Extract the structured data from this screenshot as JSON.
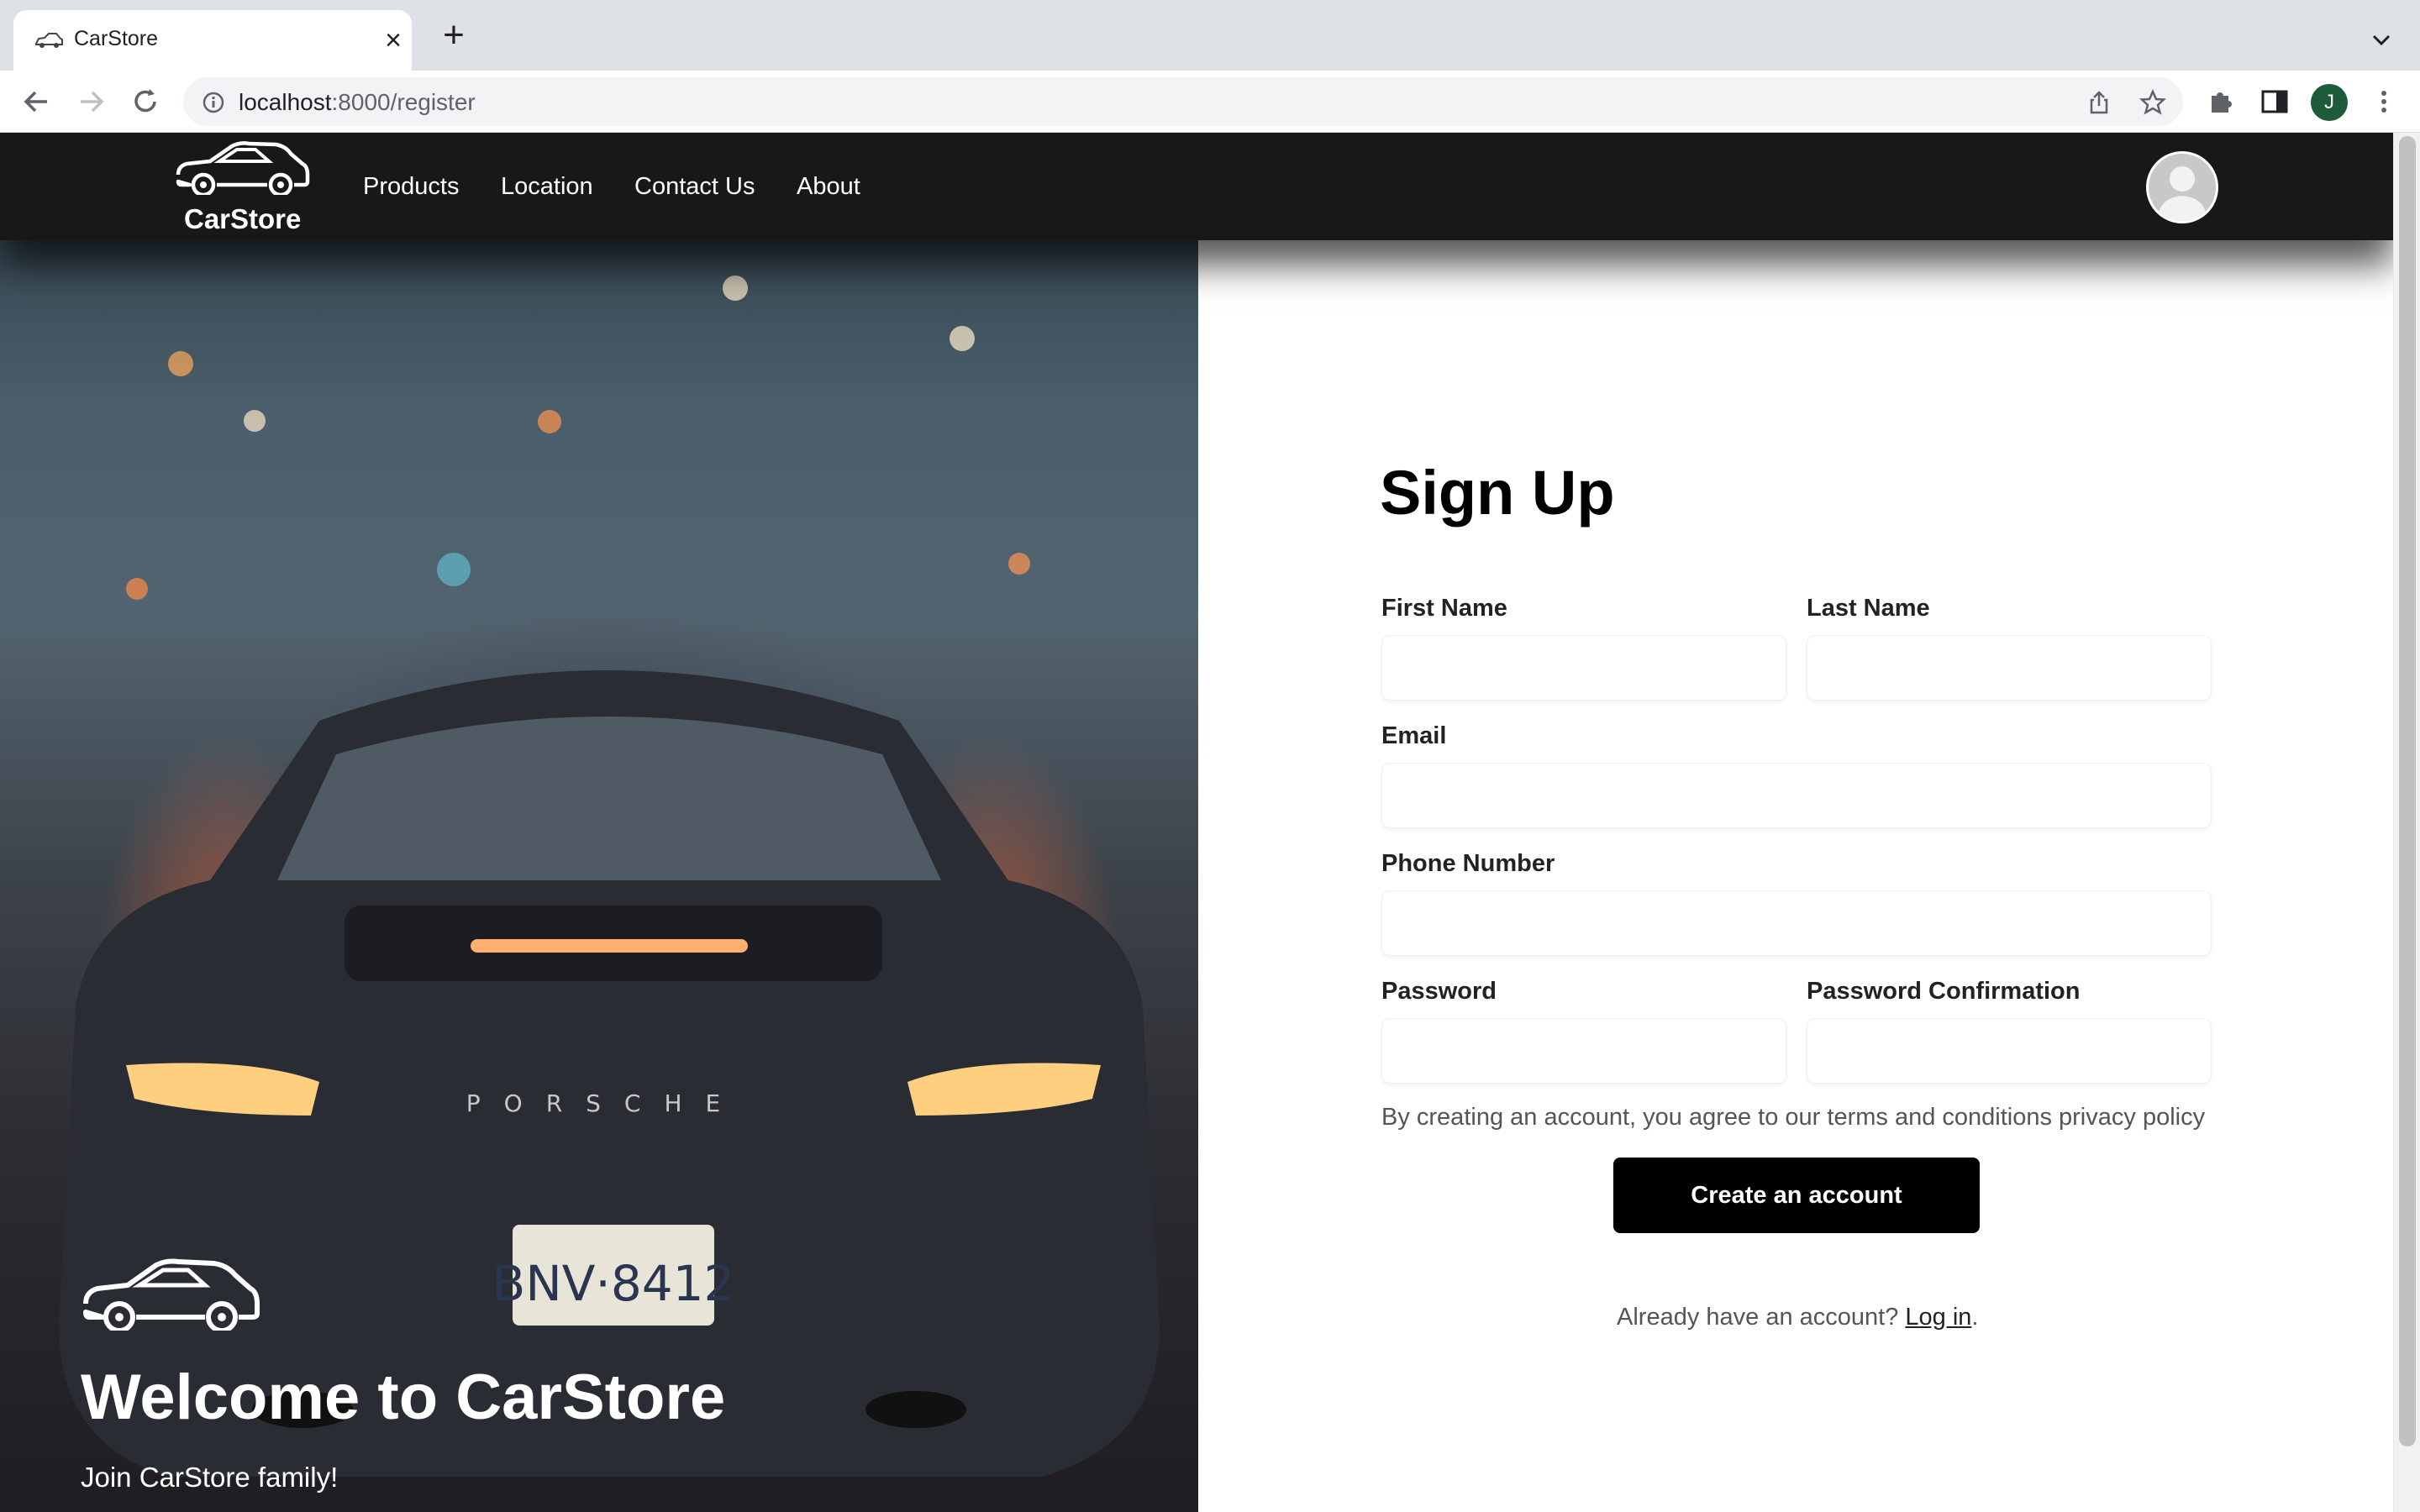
{
  "browser": {
    "tab_title": "CarStore",
    "url_host": "localhost",
    "url_path": ":8000/register",
    "profile_initial": "J"
  },
  "navbar": {
    "brand": "CarStore",
    "links": [
      "Products",
      "Location",
      "Contact Us",
      "About"
    ]
  },
  "hero": {
    "title": "Welcome to CarStore",
    "subtitle": "Join CarStore family!"
  },
  "form": {
    "title": "Sign Up",
    "fields": {
      "first_name": {
        "label": "First Name",
        "value": ""
      },
      "last_name": {
        "label": "Last Name",
        "value": ""
      },
      "email": {
        "label": "Email",
        "value": ""
      },
      "phone": {
        "label": "Phone Number",
        "value": ""
      },
      "password": {
        "label": "Password",
        "value": ""
      },
      "password_confirmation": {
        "label": "Password Confirmation",
        "value": ""
      }
    },
    "terms_text": "By creating an account, you agree to our terms and conditions privacy policy",
    "submit_label": "Create an account",
    "login_prompt": "Already have an account?",
    "login_link": "Log in",
    "login_suffix": "."
  },
  "colors": {
    "navbar_bg": "#181818",
    "button_bg": "#000000",
    "profile_chip": "#1e5b3a"
  }
}
